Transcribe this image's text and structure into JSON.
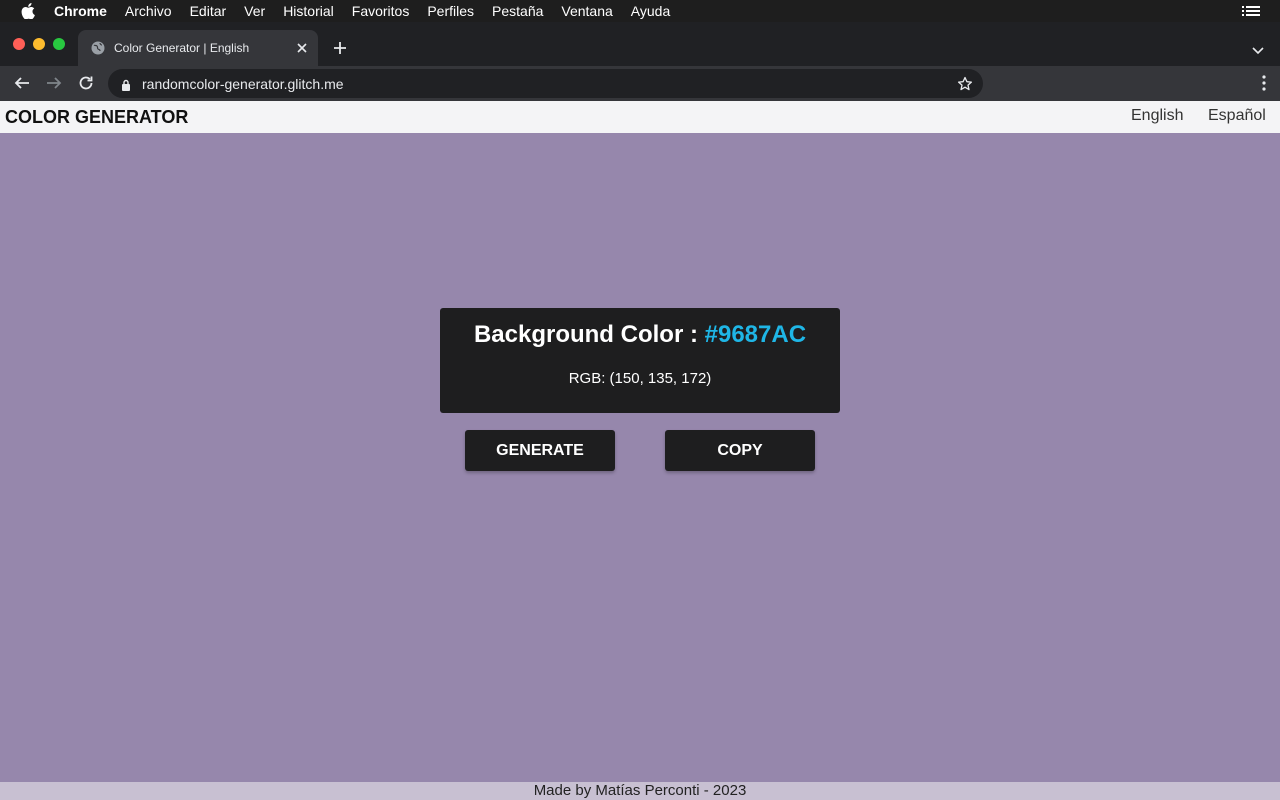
{
  "menubar": {
    "app_name": "Chrome",
    "items": [
      "Archivo",
      "Editar",
      "Ver",
      "Historial",
      "Favoritos",
      "Perfiles",
      "Pestaña",
      "Ventana",
      "Ayuda"
    ],
    "apple_icon": "apple-icon",
    "right_icon": "list-icon"
  },
  "browser": {
    "tab": {
      "title": "Color Generator | English",
      "favicon": "globe-icon"
    },
    "address": "randomcolor-generator.glitch.me"
  },
  "site": {
    "brand": "COLOR GENERATOR",
    "languages": [
      "English",
      "Español"
    ]
  },
  "card": {
    "label": "Background Color : ",
    "hex": "#9687AC",
    "rgb": "RGB: (150, 135, 172)"
  },
  "buttons": {
    "generate": "GENERATE",
    "copy": "COPY"
  },
  "footer": {
    "text": "Made by Matías Perconti - 2023"
  },
  "colors": {
    "background": "#9687AC",
    "card_bg": "#1e1e1f",
    "hex_accent": "#1fb6e6",
    "header_bg": "#f4f4f6",
    "footer_bg": "#c8c0d2"
  }
}
